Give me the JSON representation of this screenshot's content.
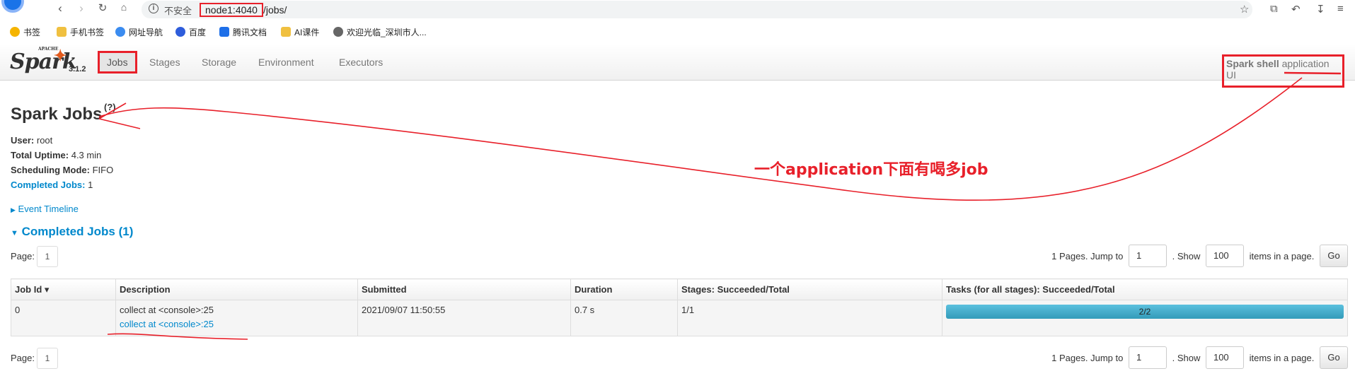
{
  "browser": {
    "insecure_label": "不安全",
    "url_host": "node1:4040",
    "url_path": "/jobs/",
    "bookmarks": [
      "书签",
      "手机书签",
      "网址导航",
      "百度",
      "腾讯文档",
      "AI课件",
      "欢迎光临_深圳市人..."
    ]
  },
  "spark": {
    "version": "3.1.2",
    "tabs": [
      "Jobs",
      "Stages",
      "Storage",
      "Environment",
      "Executors"
    ],
    "app_name": "Spark shell",
    "app_suffix": "application UI"
  },
  "page": {
    "title": "Spark Jobs",
    "help": "(?)",
    "user_label": "User:",
    "user": "root",
    "uptime_label": "Total Uptime:",
    "uptime": "4.3 min",
    "sched_label": "Scheduling Mode:",
    "sched": "FIFO",
    "completed_label": "Completed Jobs:",
    "completed": "1",
    "event_timeline": "Event Timeline",
    "completed_header": "Completed Jobs (1)"
  },
  "pager": {
    "page_label": "Page:",
    "page": "1",
    "pages_text": "1 Pages. Jump to",
    "jump_value": "1",
    "show_text": ". Show",
    "show_value": "100",
    "items_text": "items in a page.",
    "go": "Go"
  },
  "table": {
    "headers": [
      "Job Id ▾",
      "Description",
      "Submitted",
      "Duration",
      "Stages: Succeeded/Total",
      "Tasks (for all stages): Succeeded/Total"
    ],
    "rows": [
      {
        "job_id": "0",
        "desc": "collect at <console>:25",
        "desc_link": "collect at <console>:25",
        "submitted": "2021/09/07 11:50:55",
        "duration": "0.7 s",
        "stages": "1/1",
        "tasks": "2/2",
        "tasks_fraction": 1.0
      }
    ]
  },
  "annotation": {
    "text": "一个application下面有喝多job",
    "color": "#e8202a"
  }
}
